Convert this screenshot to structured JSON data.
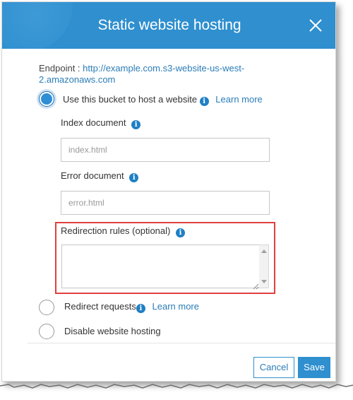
{
  "dialog": {
    "title": "Static website hosting",
    "close_icon": "close-icon"
  },
  "endpoint": {
    "label": "Endpoint :",
    "url": "http://example.com.s3-website-us-west-2.amazonaws.com"
  },
  "options": {
    "host": {
      "label": "Use this bucket to host a website",
      "learn_more": "Learn more",
      "selected": true,
      "index_document": {
        "label": "Index document",
        "placeholder": "index.html"
      },
      "error_document": {
        "label": "Error document",
        "placeholder": "error.html"
      },
      "redirection_rules": {
        "label": "Redirection rules (optional)"
      }
    },
    "redirect": {
      "label": "Redirect requests",
      "learn_more": "Learn more",
      "selected": false
    },
    "disable": {
      "label": "Disable website hosting",
      "selected": false
    }
  },
  "footer": {
    "cancel_label": "Cancel",
    "save_label": "Save"
  },
  "colors": {
    "header": "#2f8fcf",
    "link": "#2a7db8",
    "highlight": "#e0403f"
  }
}
